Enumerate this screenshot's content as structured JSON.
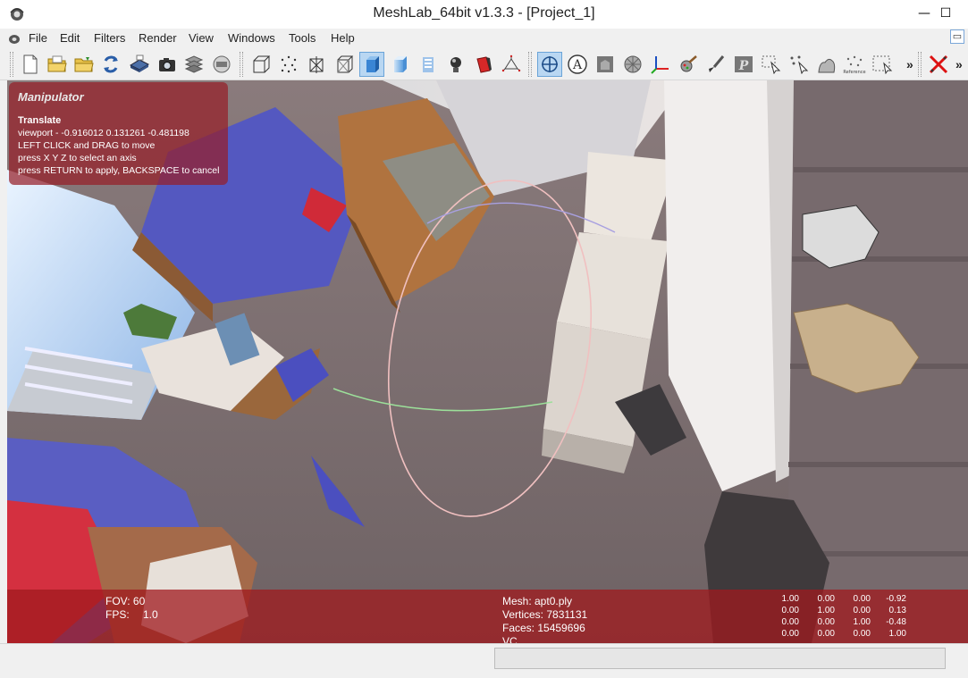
{
  "window": {
    "title": "MeshLab_64bit v1.3.3 - [Project_1]",
    "minimize_glyph": "—",
    "maximize_glyph": "☐",
    "close_glyph": "✕"
  },
  "menu": [
    "File",
    "Edit",
    "Filters",
    "Render",
    "View",
    "Windows",
    "Tools",
    "Help"
  ],
  "mdi_controls": {
    "restore_glyph": "▭",
    "close_glyph": "×"
  },
  "toolbar": {
    "more_glyph_1": "»",
    "more_glyph_2": "»",
    "more_glyph_3": "»",
    "buttons": [
      "new-project-icon",
      "open-project-icon",
      "import-mesh-icon",
      "reload-icon",
      "export-mesh-icon",
      "snapshot-icon",
      "layers-icon",
      "meshlab-server-icon",
      "bounding-box-icon",
      "points-icon",
      "wireframe-icon",
      "hidden-lines-icon",
      "flat-shading-icon",
      "smooth-shading-icon",
      "texture-icon",
      "light-icon",
      "color-icon",
      "normals-icon",
      "manipulator-icon",
      "annotate-icon",
      "measure-icon",
      "sphere-icon",
      "axis-icon",
      "paint-icon",
      "brush-icon",
      "pick-points-icon",
      "select-faces-icon",
      "select-vertices-icon",
      "align-icon",
      "reference-icon",
      "select-area-icon",
      "delete-selected-icon"
    ],
    "active": [
      "flat-shading-icon",
      "manipulator-icon"
    ],
    "reference_label": "Reference"
  },
  "manipulator": {
    "title": "Manipulator",
    "mode": "Translate",
    "lines": [
      "viewport - -0.916012 0.131261 -0.481198",
      "LEFT CLICK and DRAG to move",
      "press X Y Z to select an axis",
      "press RETURN to apply, BACKSPACE to cancel"
    ]
  },
  "info": {
    "fov": "FOV: 60",
    "fps_label": "FPS:",
    "fps_value": "1.0",
    "mesh": "Mesh: apt0.ply",
    "vertices": "Vertices: 7831131",
    "faces": "Faces: 15459696",
    "vc": "VC",
    "matrix": [
      [
        "1.00",
        "0.00",
        "0.00",
        "-0.92"
      ],
      [
        "0.00",
        "1.00",
        "0.00",
        "0.13"
      ],
      [
        "0.00",
        "0.00",
        "1.00",
        "-0.48"
      ],
      [
        "0.00",
        "0.00",
        "0.00",
        "1.00"
      ]
    ]
  },
  "status": {
    "progress": 0
  },
  "colors": {
    "overlay": "#961e28",
    "active_button": "#b9d7f2",
    "floor": "#7b6c6e"
  }
}
